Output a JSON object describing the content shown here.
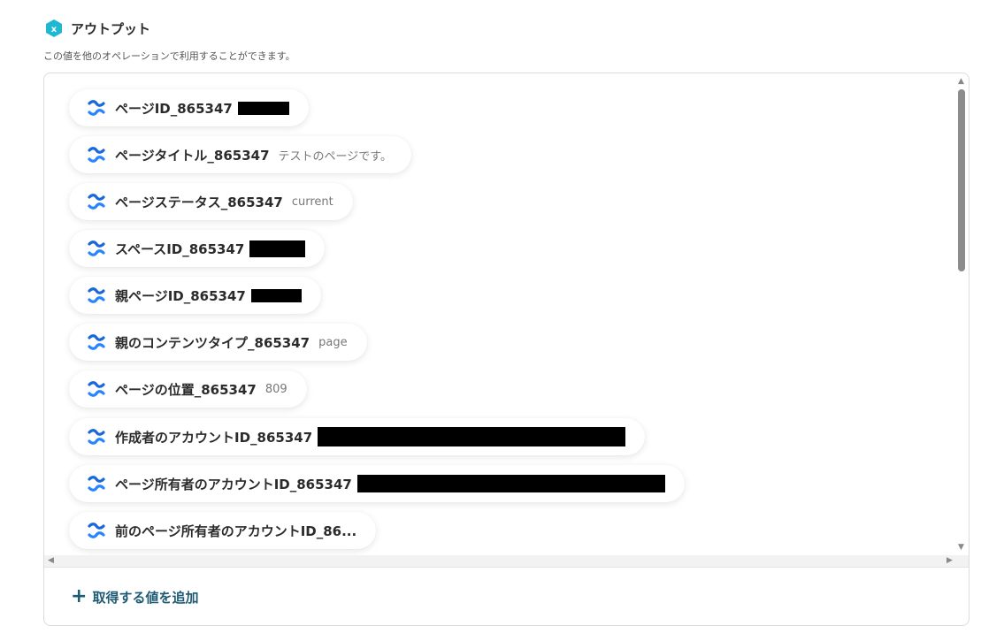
{
  "header": {
    "title": "アウトプット",
    "icon": "yoom-x-hexagon-icon",
    "icon_color": "#1fb8d3"
  },
  "subtitle": "この値を他のオペレーションで利用することができます。",
  "outputs": [
    {
      "label": "ページID_865347",
      "value": "",
      "redacted": true
    },
    {
      "label": "ページタイトル_865347",
      "value": "テストのページです。",
      "redacted": false
    },
    {
      "label": "ページステータス_865347",
      "value": "current",
      "redacted": false
    },
    {
      "label": "スペースID_865347",
      "value": "",
      "redacted": true
    },
    {
      "label": "親ページID_865347",
      "value": "",
      "redacted": true
    },
    {
      "label": "親のコンテンツタイプ_865347",
      "value": "page",
      "redacted": false
    },
    {
      "label": "ページの位置_865347",
      "value": "809",
      "redacted": false
    },
    {
      "label": "作成者のアカウントID_865347",
      "value": "",
      "redacted": true
    },
    {
      "label": "ページ所有者のアカウントID_865347",
      "value": "",
      "redacted": true
    },
    {
      "label": "前のページ所有者のアカウントID_86...",
      "value": "",
      "redacted": false
    }
  ],
  "item_icon": "confluence-icon",
  "item_icon_color": "#1868db",
  "add_button": {
    "label": "取得する値を追加",
    "icon": "plus-icon"
  }
}
